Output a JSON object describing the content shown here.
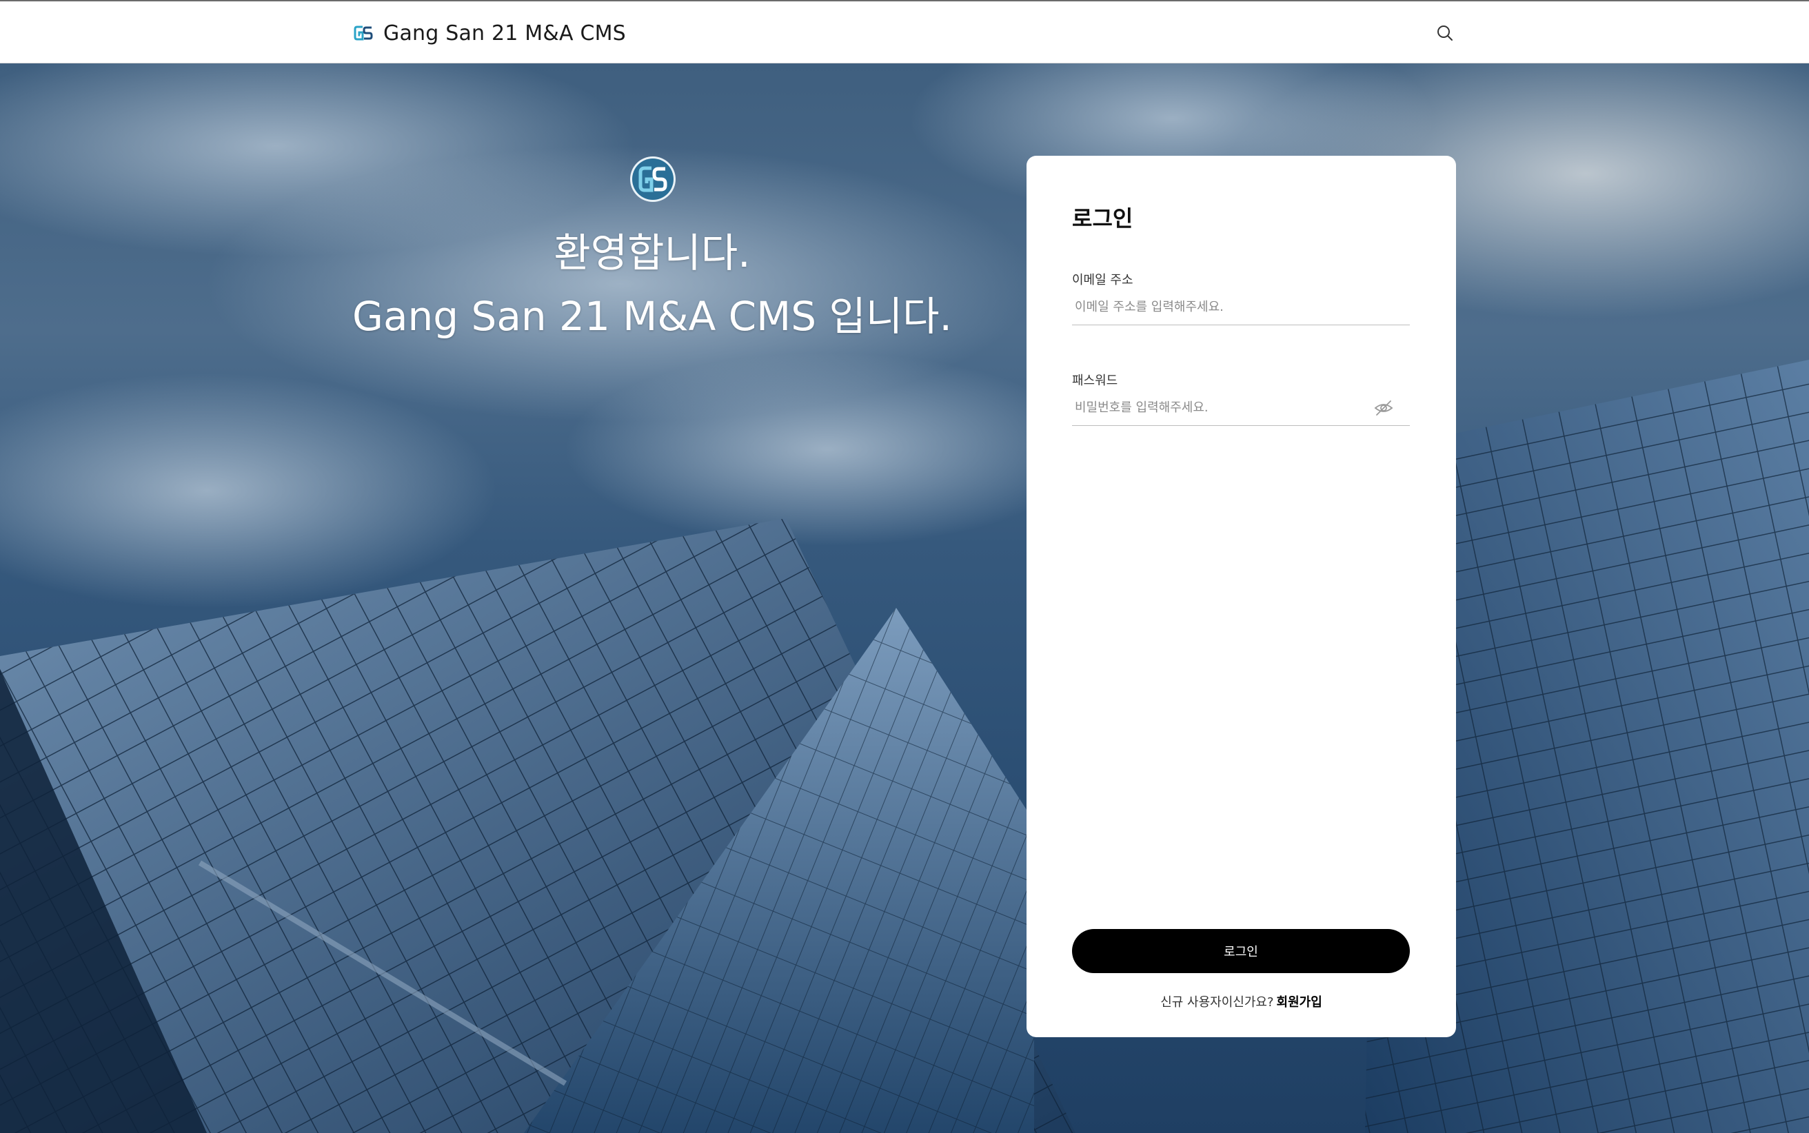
{
  "header": {
    "app_name": "Gang San 21 M&A CMS",
    "logo_icon": "gs-logo-icon",
    "search_icon": "search-icon"
  },
  "welcome": {
    "line1": "환영합니다.",
    "line2": "Gang San 21 M&A CMS 입니다."
  },
  "login": {
    "title": "로그인",
    "email_label": "이메일 주소",
    "email_placeholder": "이메일 주소를 입력해주세요.",
    "email_value": "",
    "password_label": "패스워드",
    "password_placeholder": "비밀번호를 입력해주세요.",
    "password_value": "",
    "password_toggle_icon": "eye-off-icon",
    "submit_label": "로그인",
    "signup_prompt": "신규 사용자이신가요?",
    "signup_link": "회원가입"
  },
  "colors": {
    "accent": "#000000",
    "logo_teal": "#2aa3c7",
    "logo_blue": "#1e4d7a"
  }
}
